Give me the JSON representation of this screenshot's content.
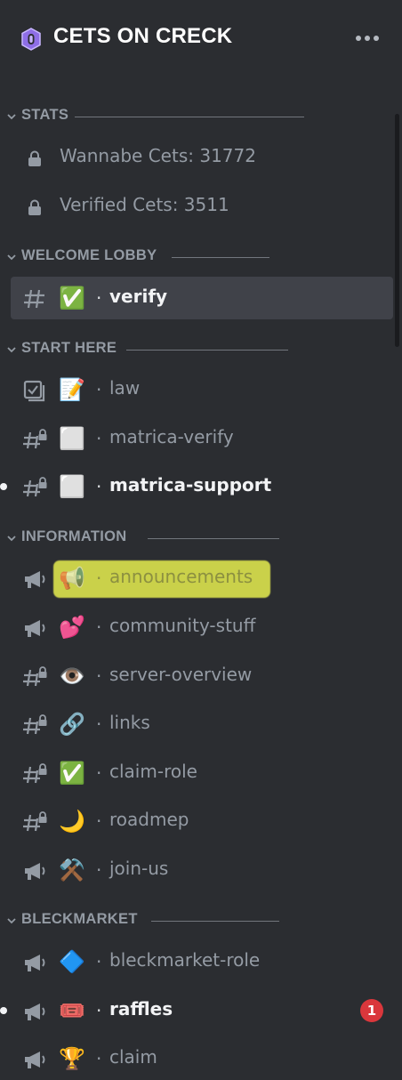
{
  "server": {
    "name": "CETS ON CRECK",
    "icon": "server-icon",
    "menu_icon": "more-dots-icon"
  },
  "categories": {
    "stats": "STATS",
    "welcome": "WELCOME LOBBY",
    "start": "START HERE",
    "information": "INFORMATION",
    "bleckmarket": "BLECKMARKET"
  },
  "stats": [
    {
      "text": "Wannabe Cets: 31772",
      "icon": "lock-icon"
    },
    {
      "text": "Verified Cets: 3511",
      "icon": "lock-icon"
    }
  ],
  "channels": {
    "verify": {
      "emoji": "✅",
      "name": "verify",
      "type": "text"
    },
    "law": {
      "emoji": "📝",
      "name": "law",
      "type": "rules"
    },
    "matrica_verify": {
      "emoji": "⬜",
      "name": "matrica-verify",
      "type": "locked-text"
    },
    "matrica_support": {
      "emoji": "⬜",
      "name": "matrica-support",
      "type": "locked-text"
    },
    "announcements": {
      "emoji": "📢",
      "name": "announcements",
      "type": "announcement"
    },
    "community_stuff": {
      "emoji": "💕",
      "name": "community-stuff",
      "type": "announcement"
    },
    "server_overview": {
      "emoji": "👁️",
      "name": "server-overview",
      "type": "locked-text"
    },
    "links": {
      "emoji": "🔗",
      "name": "links",
      "type": "locked-text"
    },
    "claim_role": {
      "emoji": "✅",
      "name": "claim-role",
      "type": "locked-text"
    },
    "roadmep": {
      "emoji": "🌙",
      "name": "roadmep",
      "type": "locked-text"
    },
    "join_us": {
      "emoji": "⚒️",
      "name": "join-us",
      "type": "announcement"
    },
    "bleckmarket_role": {
      "emoji": "🔷",
      "name": "bleckmarket-role",
      "type": "announcement"
    },
    "raffles": {
      "emoji": "🎟️",
      "name": "raffles",
      "type": "announcement",
      "badge": "1"
    },
    "claim": {
      "emoji": "🏆",
      "name": "claim",
      "type": "announcement"
    }
  },
  "separator": "·",
  "colors": {
    "background": "#2b2d31",
    "selected": "#404249",
    "badge": "#da373c",
    "highlight": "#eef550"
  }
}
